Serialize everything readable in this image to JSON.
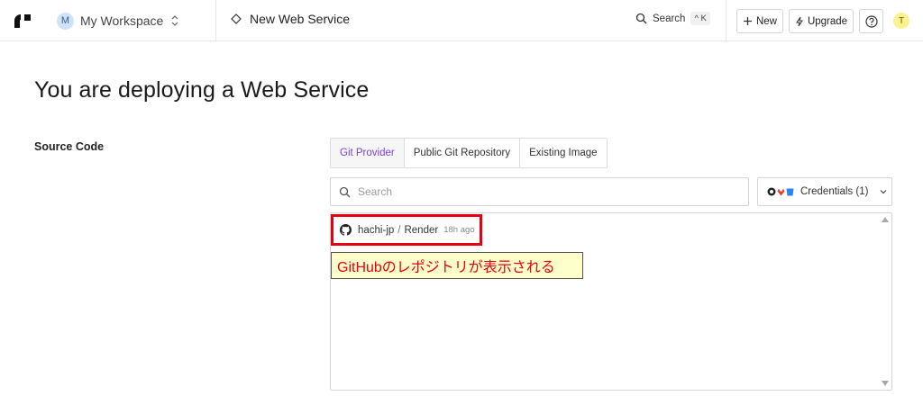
{
  "header": {
    "workspace_initial": "M",
    "workspace_name": "My Workspace",
    "breadcrumb": "New Web Service",
    "search_label": "Search",
    "search_shortcut": "^ K",
    "new_label": "New",
    "upgrade_label": "Upgrade",
    "user_initial": "T"
  },
  "main": {
    "title": "You are deploying a Web Service",
    "section_label": "Source Code",
    "tabs": [
      {
        "label": "Git Provider",
        "active": true
      },
      {
        "label": "Public Git Repository",
        "active": false
      },
      {
        "label": "Existing Image",
        "active": false
      }
    ],
    "search": {
      "placeholder": "Search",
      "value": ""
    },
    "credentials_label": "Credentials (1)",
    "repos": [
      {
        "owner": "hachi-jp",
        "separator": "/",
        "name": "Render",
        "time": "18h ago"
      }
    ]
  },
  "annotation": {
    "text": "GitHubのレポジトリが表示される"
  },
  "colors": {
    "accent": "#7b3fe4",
    "highlight_border": "#e60012",
    "callout_bg": "#ffffcc",
    "callout_text": "#e60012"
  },
  "icons": [
    "render-logo-icon",
    "chevron-updown-icon",
    "diamond-icon",
    "search-icon",
    "plus-icon",
    "bolt-icon",
    "help-icon",
    "github-icon",
    "gitlab-icon",
    "bitbucket-icon",
    "chevron-down-icon"
  ]
}
